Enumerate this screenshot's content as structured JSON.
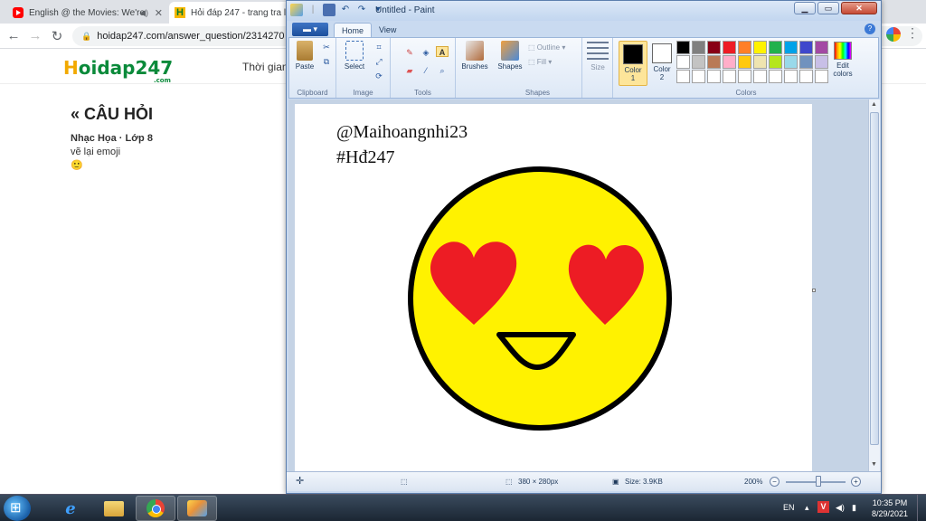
{
  "browser": {
    "tabs": [
      {
        "title": "English @ the Movies: We're"
      },
      {
        "title": "Hỏi đáp 247 - trang tra lời"
      }
    ],
    "url": "hoidap247.com/answer_question/2314270"
  },
  "site": {
    "logo": "oidap247",
    "logo_h": "H",
    "logo_suffix": ".com",
    "nav_item": "Thời gian",
    "section_title": "« CÂU HỎI",
    "subject": "Nhạc Họa · Lớp 8",
    "question_text": "vẽ lại emoji",
    "question_emoji": "🙂"
  },
  "paint": {
    "window_title": "Untitled - Paint",
    "file_button": "▬ ▾",
    "tabs": {
      "home": "Home",
      "view": "View"
    },
    "groups": {
      "clipboard": "Clipboard",
      "image": "Image",
      "tools": "Tools",
      "shapes": "Shapes",
      "colors": "Colors"
    },
    "buttons": {
      "paste": "Paste",
      "select": "Select",
      "brushes": "Brushes",
      "shapes": "Shapes",
      "size": "Size",
      "outline": "Outline",
      "fill": "Fill",
      "color1": "Color\n1",
      "color2": "Color\n2",
      "edit_colors": "Edit colors"
    },
    "color1_value": "#000000",
    "color2_value": "#ffffff",
    "palette": [
      "#000000",
      "#7f7f7f",
      "#880015",
      "#ed1c24",
      "#ff7f27",
      "#fff200",
      "#22b14c",
      "#00a2e8",
      "#3f48cc",
      "#a349a4",
      "#ffffff",
      "#c3c3c3",
      "#b97a57",
      "#ffaec9",
      "#ffc90e",
      "#efe4b0",
      "#b5e61d",
      "#99d9ea",
      "#7092be",
      "#c8bfe7",
      "#ffffff",
      "#ffffff",
      "#ffffff",
      "#ffffff",
      "#ffffff",
      "#ffffff",
      "#ffffff",
      "#ffffff",
      "#ffffff",
      "#ffffff"
    ],
    "canvas": {
      "line1": "@Maihoangnhi23",
      "line2": "#Hđ247",
      "face_color": "#fff200",
      "heart_color": "#ed1c24",
      "outline_color": "#000000"
    },
    "status": {
      "dimensions": "380 × 280px",
      "size": "Size: 3.9KB",
      "zoom": "200%"
    }
  },
  "taskbar": {
    "lang": "EN",
    "time": "10:35 PM",
    "date": "8/29/2021"
  }
}
